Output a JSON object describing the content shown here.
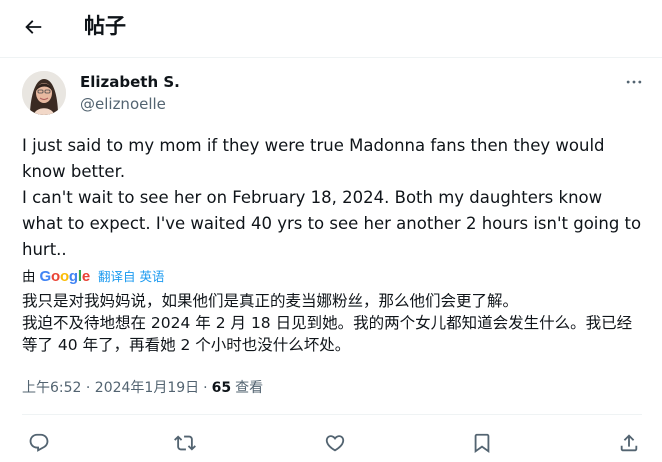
{
  "header": {
    "back_icon": "arrow-left-icon",
    "title": "帖子"
  },
  "author": {
    "name": "Elizabeth S.",
    "handle": "@eliznoelle"
  },
  "tweet": {
    "text": "I just said to my mom if they were true Madonna fans then they would know better.\nI can't wait to see her on February 18, 2024. Both my daughters know what to expect. I've waited 40 yrs to see her another 2 hours isn't going to hurt.."
  },
  "translation": {
    "by_label": "由",
    "provider": "Google",
    "link_label": "翻译自 英语",
    "text": "我只是对我妈妈说，如果他们是真正的麦当娜粉丝，那么他们会更了解。\n我迫不及待地想在 2024 年 2 月 18 日见到她。我的两个女儿都知道会发生什么。我已经等了 40 年了，再看她 2 个小时也没什么坏处。"
  },
  "meta": {
    "timestamp": "上午6:52 · 2024年1月19日",
    "separator": "·",
    "views_count": "65",
    "views_label": "查看"
  },
  "colors": {
    "text": "#0f1419",
    "secondary": "#536471",
    "link": "#1d9bf0",
    "divider": "#eff3f4"
  },
  "actions": [
    "reply-icon",
    "retweet-icon",
    "like-icon",
    "bookmark-icon",
    "share-icon"
  ]
}
